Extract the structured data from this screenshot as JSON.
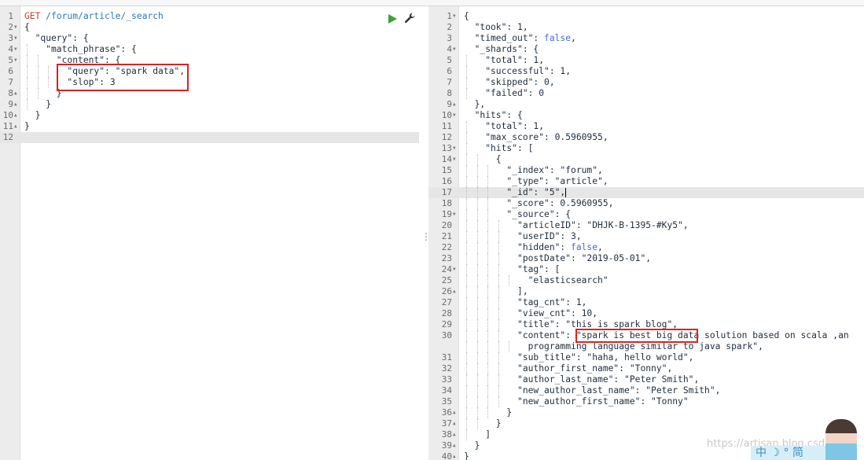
{
  "request": {
    "lines": [
      "GET /forum/article/_search",
      "{",
      "  \"query\": {",
      "    \"match_phrase\": {",
      "      \"content\": {",
      "        \"query\": \"spark data\",",
      "        \"slop\": 3",
      "      }",
      "    }",
      "  }",
      "}",
      ""
    ],
    "folds": [
      2,
      3,
      4,
      5,
      8,
      9,
      10,
      11
    ],
    "fold_ends": [
      8,
      9,
      10,
      11
    ],
    "active_line": 12,
    "method": "GET",
    "path": "/forum/article/_search"
  },
  "response": {
    "lines": [
      "{",
      "  \"took\": 1,",
      "  \"timed_out\": false,",
      "  \"_shards\": {",
      "    \"total\": 1,",
      "    \"successful\": 1,",
      "    \"skipped\": 0,",
      "    \"failed\": 0",
      "  },",
      "  \"hits\": {",
      "    \"total\": 1,",
      "    \"max_score\": 0.5960955,",
      "    \"hits\": [",
      "      {",
      "        \"_index\": \"forum\",",
      "        \"_type\": \"article\",",
      "        \"_id\": \"5\",",
      "        \"_score\": 0.5960955,",
      "        \"_source\": {",
      "          \"articleID\": \"DHJK-B-1395-#Ky5\",",
      "          \"userID\": 3,",
      "          \"hidden\": false,",
      "          \"postDate\": \"2019-05-01\",",
      "          \"tag\": [",
      "            \"elasticsearch\"",
      "          ],",
      "          \"tag_cnt\": 1,",
      "          \"view_cnt\": 10,",
      "          \"title\": \"this is spark blog\",",
      "          \"content\": \"spark is best big data solution based on scala ,an",
      "            programming language similar to java spark\",",
      "          \"sub_title\": \"haha, hello world\",",
      "          \"author_first_name\": \"Tonny\",",
      "          \"author_last_name\": \"Peter Smith\",",
      "          \"new_author_last_name\": \"Peter Smith\",",
      "          \"new_author_first_name\": \"Tonny\"",
      "        }",
      "      }",
      "    ]",
      "  }",
      "}"
    ],
    "line_numbers": [
      "1",
      "2",
      "3",
      "4",
      "5",
      "6",
      "7",
      "8",
      "9",
      "10",
      "11",
      "12",
      "13",
      "14",
      "15",
      "16",
      "17",
      "18",
      "19",
      "20",
      "21",
      "22",
      "23",
      "24",
      "25",
      "26",
      "27",
      "28",
      "29",
      "30",
      "",
      "31",
      "32",
      "33",
      "34",
      "35",
      "36",
      "37",
      "38",
      "39",
      "40"
    ],
    "folds": [
      "1",
      "4",
      "9",
      "10",
      "13",
      "14",
      "19",
      "24",
      "26",
      "36",
      "37",
      "38",
      "39",
      "40"
    ],
    "fold_ends": [
      "9",
      "26",
      "36",
      "37",
      "38",
      "39",
      "40"
    ],
    "active_line": "17"
  },
  "watermark": "https://artisan.blog.csdn.net",
  "ime_text": "中 ☽ ° 简",
  "colors": {
    "highlight": "#e02020",
    "run": "#3aa43a",
    "keyword": "#c83a3a",
    "path": "#2a77b8",
    "boolean": "#4a6ad8"
  }
}
